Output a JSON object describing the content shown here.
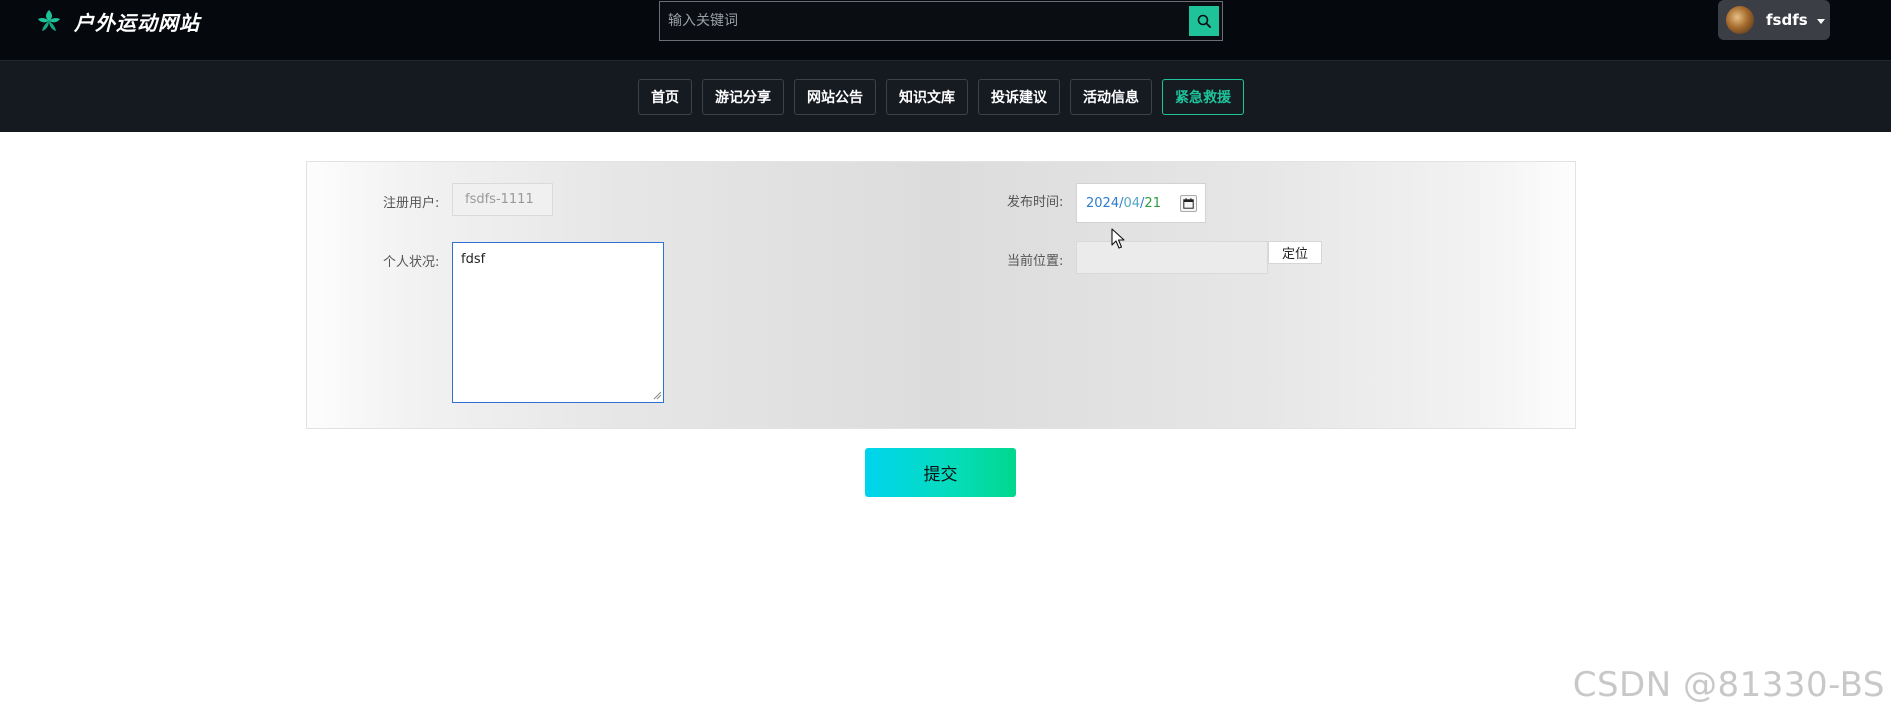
{
  "header": {
    "site_name": "户外运动网站",
    "logo_icon": "flower-leaf-icon",
    "search": {
      "placeholder": "输入关键词",
      "value": "",
      "button_icon": "search-icon"
    },
    "user": {
      "name": "fsdfs",
      "avatar": "avatar-image",
      "dropdown_icon": "caret-down-icon"
    }
  },
  "nav": {
    "items": [
      {
        "label": "首页"
      },
      {
        "label": "游记分享"
      },
      {
        "label": "网站公告"
      },
      {
        "label": "知识文库"
      },
      {
        "label": "投诉建议"
      },
      {
        "label": "活动信息"
      },
      {
        "label": "紧急救援",
        "active": true
      }
    ]
  },
  "form": {
    "registered_user": {
      "label": "注册用户:",
      "value": "fsdfs-1111"
    },
    "personal_status": {
      "label": "个人状况:",
      "value": "fdsf"
    },
    "publish_time": {
      "label": "发布时间:",
      "year": "2024",
      "month": "04",
      "day": "21",
      "separator": "/",
      "button_icon": "calendar-icon"
    },
    "current_location": {
      "label": "当前位置:",
      "value": "",
      "locate_button": "定位"
    }
  },
  "submit_label": "提交",
  "watermark": "CSDN @81330-BS",
  "colors": {
    "accent": "#1ec39a",
    "header_bg": "#05080d",
    "nav_bg": "#151a21",
    "submit_gradient_start": "#00d4ee",
    "submit_gradient_end": "#00d88d"
  }
}
